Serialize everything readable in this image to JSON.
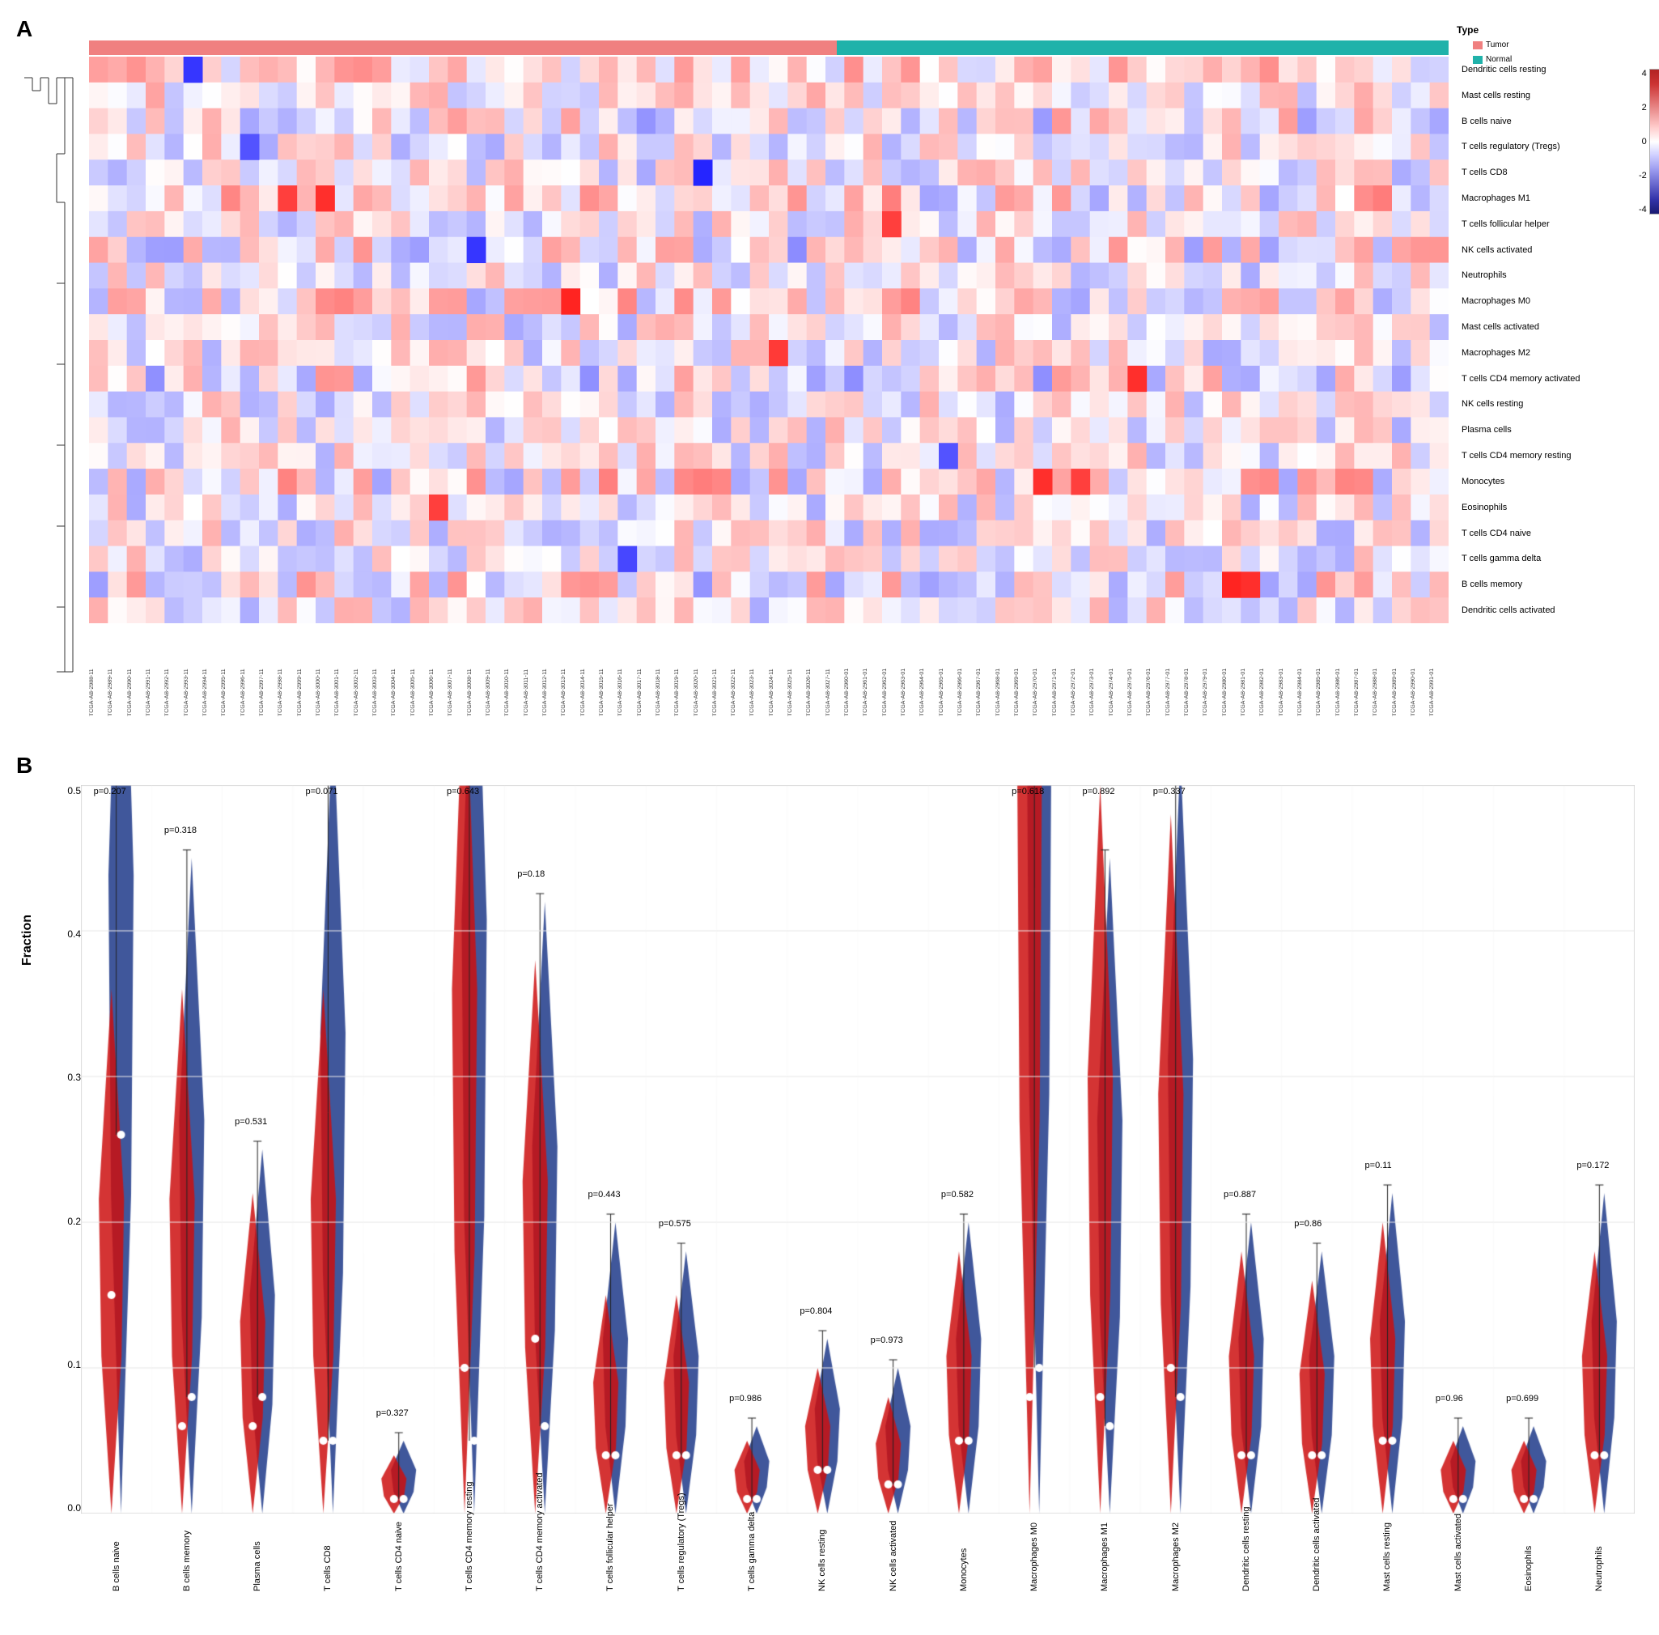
{
  "panel_a": {
    "label": "A",
    "type_label": "Type",
    "type_colors": {
      "salmon": "#F08080",
      "teal": "#20B2AA"
    },
    "row_labels": [
      "Dendritic cells resting",
      "Mast cells resting",
      "B cells naive",
      "T cells regulatory (Tregs)",
      "T cells CD8",
      "Macrophages M1",
      "T cells follicular helper",
      "NK cells activated",
      "Neutrophils",
      "Macrophages M0",
      "Mast cells activated",
      "Macrophages M2",
      "T cells CD4 memory activated",
      "NK cells resting",
      "Plasma cells",
      "T cells CD4 memory resting",
      "Monocytes",
      "Eosinophils",
      "T cells CD4 naive",
      "T cells gamma delta",
      "B cells memory",
      "Dendritic cells activated"
    ],
    "legend_values": [
      "4",
      "2",
      "0",
      "-2",
      "-4"
    ],
    "color_scale": {
      "high": "#B22222",
      "mid": "white",
      "low": "#191970"
    }
  },
  "panel_b": {
    "label": "B",
    "y_axis_label": "Fraction",
    "y_ticks": [
      "0.5",
      "0.4",
      "0.3",
      "0.2",
      "0.1",
      "0.0"
    ],
    "violin_groups": [
      {
        "name": "B cells naive",
        "pval": "p=0.207"
      },
      {
        "name": "B cells memory",
        "pval": "p=0.318"
      },
      {
        "name": "Plasma cells",
        "pval": "p=0.531"
      },
      {
        "name": "T cells CD8",
        "pval": "p=0.071"
      },
      {
        "name": "T cells CD4 naive",
        "pval": "p=0.327"
      },
      {
        "name": "T cells CD4 memory resting",
        "pval": "p=0.643"
      },
      {
        "name": "T cells CD4 memory activated",
        "pval": "p=0.18"
      },
      {
        "name": "T cells follicular helper",
        "pval": "p=0.443"
      },
      {
        "name": "T cells regulatory (Tregs)",
        "pval": "p=0.575"
      },
      {
        "name": "T cells gamma delta",
        "pval": "p=0.986"
      },
      {
        "name": "NK cells resting",
        "pval": "p=0.804"
      },
      {
        "name": "NK cells activated",
        "pval": "p=0.973"
      },
      {
        "name": "Monocytes",
        "pval": "p=0.582"
      },
      {
        "name": "Macrophages M0",
        "pval": "p=0.618"
      },
      {
        "name": "Macrophages M1",
        "pval": "p=0.892"
      },
      {
        "name": "Macrophages M2",
        "pval": "p=0.337"
      },
      {
        "name": "Dendritic cells resting",
        "pval": "p=0.887"
      },
      {
        "name": "Dendritic cells activated",
        "pval": "p=0.86"
      },
      {
        "name": "Mast cells resting",
        "pval": "p=0.11"
      },
      {
        "name": "Mast cells activated",
        "pval": "p=0.96"
      },
      {
        "name": "Eosinophils",
        "pval": "p=0.699"
      },
      {
        "name": "Neutrophils",
        "pval": "p=0.172"
      }
    ]
  }
}
